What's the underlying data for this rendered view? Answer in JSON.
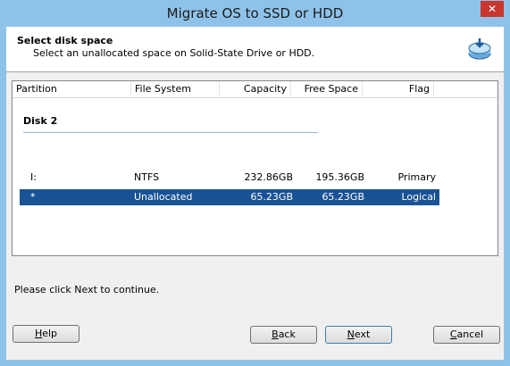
{
  "window": {
    "title": "Migrate OS to SSD or HDD"
  },
  "header": {
    "title": "Select disk space",
    "subtitle": "Select an unallocated space on Solid-State Drive or HDD."
  },
  "table": {
    "columns": [
      "Partition",
      "File System",
      "Capacity",
      "Free Space",
      "Flag"
    ],
    "disk_label": "Disk 2",
    "rows": [
      {
        "partition": "I:",
        "filesystem": "NTFS",
        "capacity": "232.86GB",
        "free": "195.36GB",
        "flag": "Primary",
        "selected": false
      },
      {
        "partition": "*",
        "filesystem": "Unallocated",
        "capacity": "65.23GB",
        "free": "65.23GB",
        "flag": "Logical",
        "selected": true
      }
    ]
  },
  "status": "Please click Next to continue.",
  "buttons": {
    "help": {
      "first": "H",
      "rest": "elp"
    },
    "back": {
      "first": "B",
      "rest": "ack"
    },
    "next": {
      "first": "N",
      "rest": "ext"
    },
    "cancel": {
      "first": "C",
      "rest": "ancel"
    }
  },
  "colors": {
    "title_bar": "#8fc2e9",
    "selection": "#1a5395",
    "close": "#c7372f"
  }
}
